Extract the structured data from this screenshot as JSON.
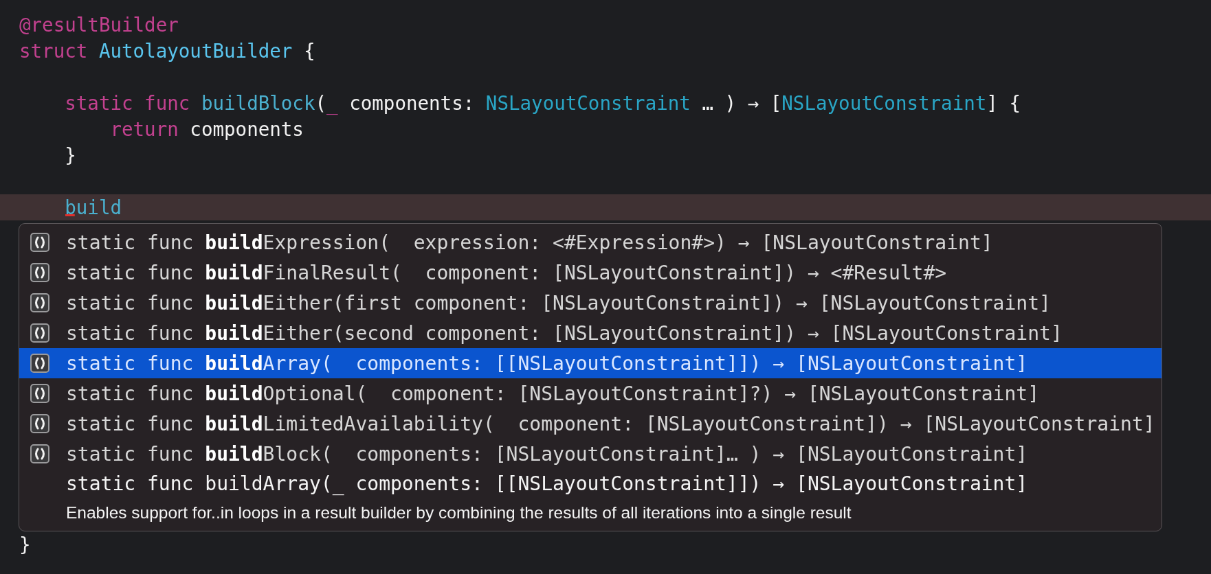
{
  "editor": {
    "code_blocks": [
      {
        "lines": [
          {
            "current": false,
            "tokens": [
              {
                "kind": "keyword",
                "text": "@resultBuilder"
              }
            ]
          },
          {
            "current": false,
            "tokens": [
              {
                "kind": "keyword",
                "text": "struct "
              },
              {
                "kind": "declaration",
                "text": "AutolayoutBuilder"
              },
              {
                "kind": "plain",
                "text": " {"
              }
            ]
          }
        ]
      },
      {
        "lines": [
          {
            "current": false,
            "tokens": [
              {
                "kind": "keyword",
                "text": "    static func "
              },
              {
                "kind": "function",
                "text": "buildBlock"
              },
              {
                "kind": "plain",
                "text": "("
              },
              {
                "kind": "keyword",
                "text": "_"
              },
              {
                "kind": "plain",
                "text": " components: "
              },
              {
                "kind": "type",
                "text": "NSLayoutConstraint"
              },
              {
                "kind": "plain",
                "text": " … ) → ["
              },
              {
                "kind": "type",
                "text": "NSLayoutConstraint"
              },
              {
                "kind": "plain",
                "text": "] {"
              }
            ]
          },
          {
            "current": false,
            "tokens": [
              {
                "kind": "keyword",
                "text": "        return"
              },
              {
                "kind": "plain",
                "text": " components"
              }
            ]
          },
          {
            "current": false,
            "tokens": [
              {
                "kind": "plain",
                "text": "    }"
              }
            ]
          }
        ]
      },
      {
        "lines": [
          {
            "current": true,
            "tokens": [
              {
                "kind": "typed",
                "text": "    build"
              }
            ]
          }
        ]
      }
    ],
    "completion_popup": {
      "items": [
        {
          "selected": false,
          "text": "static func **build**Expression(  expression: <#Expression#>) → [NSLayoutConstraint]"
        },
        {
          "selected": false,
          "text": "static func **build**FinalResult(  component: [NSLayoutConstraint]) → <#Result#>"
        },
        {
          "selected": false,
          "text": "static func **build**Either(first component: [NSLayoutConstraint]) → [NSLayoutConstraint]"
        },
        {
          "selected": false,
          "text": "static func **build**Either(second component: [NSLayoutConstraint]) → [NSLayoutConstraint]"
        },
        {
          "selected": true,
          "text": "static func **build**Array(  components: [[NSLayoutConstraint]]) → [NSLayoutConstraint]"
        },
        {
          "selected": false,
          "text": "static func **build**Optional(  component: [NSLayoutConstraint]?) → [NSLayoutConstraint]"
        },
        {
          "selected": false,
          "text": "static func **build**LimitedAvailability(  component: [NSLayoutConstraint]) → [NSLayoutConstraint]"
        },
        {
          "selected": false,
          "text": "static func **build**Block(  components: [NSLayoutConstraint]… ) → [NSLayoutConstraint]"
        }
      ],
      "detail": {
        "signature": "static func buildArray(_ components: [[NSLayoutConstraint]]) → [NSLayoutConstraint]",
        "description": "Enables support for..in loops in a result builder by combining the results of all iterations into a single result"
      }
    },
    "code_lines_after": [
      {
        "current": false,
        "tokens": [
          {
            "kind": "plain",
            "text": "}"
          }
        ]
      }
    ]
  }
}
